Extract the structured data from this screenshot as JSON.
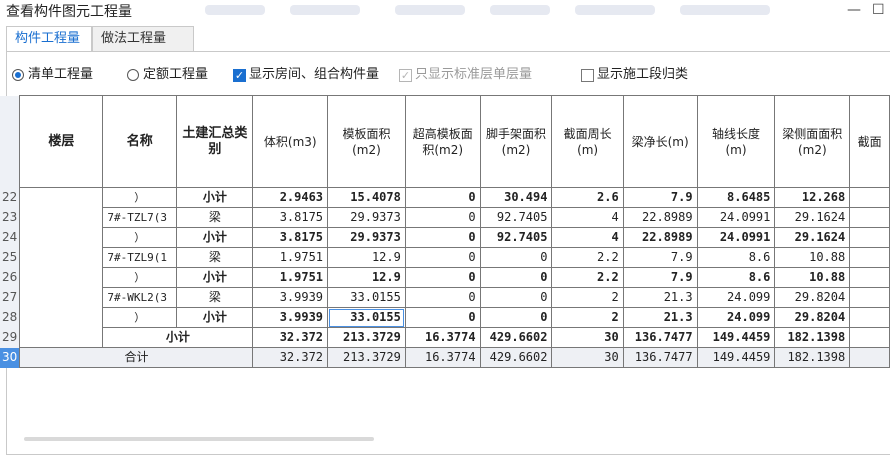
{
  "window": {
    "title": "查看构件图元工程量",
    "minimize_glyph": "—",
    "maximize_glyph": "☐"
  },
  "tabs": [
    {
      "label": "构件工程量",
      "active": true
    },
    {
      "label": "做法工程量",
      "active": false
    }
  ],
  "options": {
    "radio_qingdan": "清单工程量",
    "radio_dinge": "定额工程量",
    "check_show_rooms": "显示房间、组合构件量",
    "check_standard_floor": "只显示标准层单层量",
    "check_section": "显示施工段归类"
  },
  "columns": [
    "楼层",
    "名称",
    "土建汇总类别",
    "体积(m3)",
    "模板面积(m2)",
    "超高模板面积(m2)",
    "脚手架面积(m2)",
    "截面周长(m)",
    "梁净长(m)",
    "轴线长度(m)",
    "梁侧面面积(m2)",
    "截面"
  ],
  "rows": [
    {
      "num": "22",
      "name": "）",
      "cat": "小计",
      "v": [
        "2.9463",
        "15.4078",
        "0",
        "30.494",
        "2.6",
        "7.9",
        "8.6485",
        "12.268"
      ],
      "bold": true
    },
    {
      "num": "23",
      "name": "7#-TZL7(3",
      "cat": "梁",
      "v": [
        "3.8175",
        "29.9373",
        "0",
        "92.7405",
        "4",
        "22.8989",
        "24.0991",
        "29.1624"
      ],
      "bold": false
    },
    {
      "num": "24",
      "name": "）",
      "cat": "小计",
      "v": [
        "3.8175",
        "29.9373",
        "0",
        "92.7405",
        "4",
        "22.8989",
        "24.0991",
        "29.1624"
      ],
      "bold": true
    },
    {
      "num": "25",
      "name": "7#-TZL9(1",
      "cat": "梁",
      "v": [
        "1.9751",
        "12.9",
        "0",
        "0",
        "2.2",
        "7.9",
        "8.6",
        "10.88"
      ],
      "bold": false
    },
    {
      "num": "26",
      "name": "）",
      "cat": "小计",
      "v": [
        "1.9751",
        "12.9",
        "0",
        "0",
        "2.2",
        "7.9",
        "8.6",
        "10.88"
      ],
      "bold": true
    },
    {
      "num": "27",
      "name": "7#-WKL2(3",
      "cat": "梁",
      "v": [
        "3.9939",
        "33.0155",
        "0",
        "0",
        "2",
        "21.3",
        "24.099",
        "29.8204"
      ],
      "bold": false
    },
    {
      "num": "28",
      "name": "）",
      "cat": "小计",
      "v": [
        "3.9939",
        "33.0155",
        "0",
        "0",
        "2",
        "21.3",
        "24.099",
        "29.8204"
      ],
      "bold": true
    }
  ],
  "subtotal_row": {
    "num": "29",
    "label": "小计",
    "v": [
      "32.372",
      "213.3729",
      "16.3774",
      "429.6602",
      "30",
      "136.7477",
      "149.4459",
      "182.1398"
    ]
  },
  "total_row": {
    "num": "30",
    "label": "合计",
    "v": [
      "32.372",
      "213.3729",
      "16.3774",
      "429.6602",
      "30",
      "136.7477",
      "149.4459",
      "182.1398"
    ]
  },
  "colors": {
    "accent": "#1a6fd0",
    "rownum_bg": "#eef1f6",
    "selected_row": "#4a90e2"
  }
}
